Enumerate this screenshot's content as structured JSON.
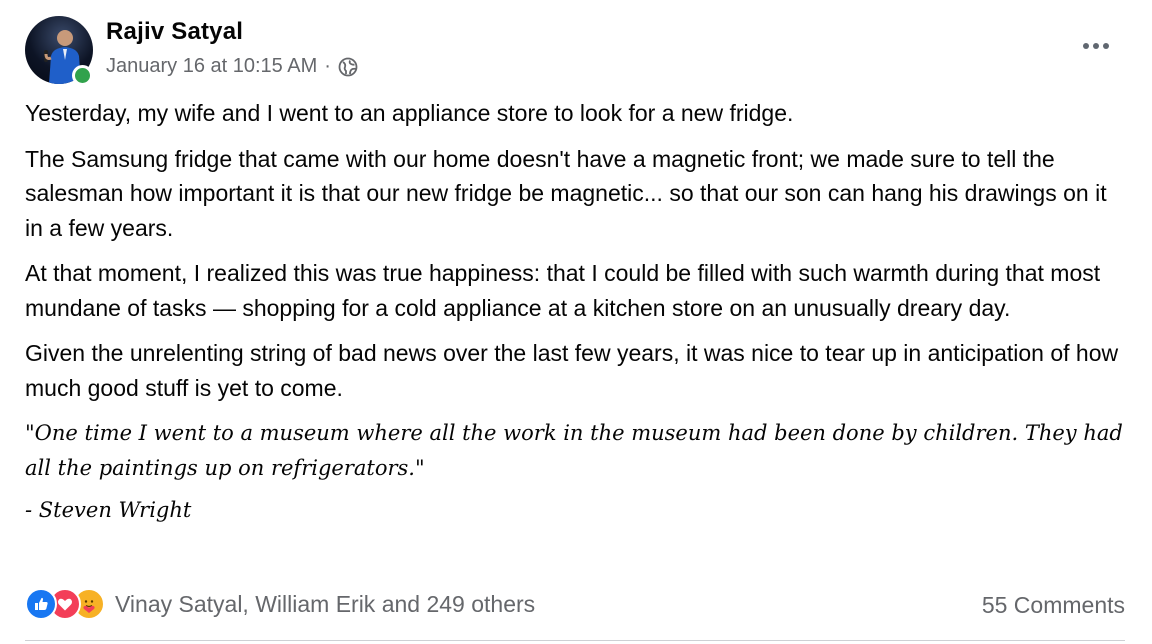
{
  "post": {
    "author": "Rajiv Satyal",
    "timestamp": "January 16 at 10:15 AM",
    "separator": "·",
    "privacy_icon": "globe-icon",
    "more_icon": "more-options-icon",
    "paragraphs": [
      "Yesterday, my wife and I went to an appliance store to look for a new fridge.",
      "The Samsung fridge that came with our home doesn't have a magnetic front; we made sure to tell the salesman how important it is that our new fridge be magnetic... so that our son can hang his drawings on it in a few years.",
      "At that moment, I realized this was true happiness:  that I could be filled with such warmth during that most mundane of tasks — shopping for a cold appliance at a kitchen store on an unusually dreary day.",
      "Given the unrelenting string of bad news over the last few years, it was nice to tear up in anticipation of how much good stuff is yet to come."
    ],
    "quote": "\"One time I went to a museum where all the work in the museum had been done by children. They had all the paintings up on refrigerators.\"",
    "attribution": "- Steven Wright"
  },
  "footer": {
    "reaction_icons": [
      "like-icon",
      "love-icon",
      "care-icon"
    ],
    "reactors": "Vinay Satyal, William Erik and 249 others",
    "comments": "55 Comments"
  },
  "colors": {
    "online": "#31a24c",
    "secondary_text": "#65676b",
    "like": "#1877f2",
    "love": "#f33e58",
    "care": "#f7b125"
  }
}
